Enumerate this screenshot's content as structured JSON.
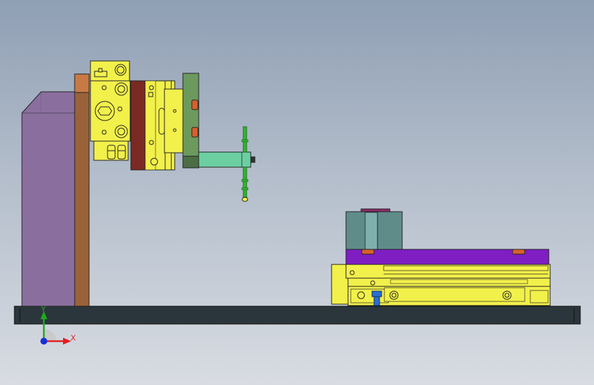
{
  "viewport": {
    "background_top": "#8f9fb4",
    "background_bottom": "#d8dce2"
  },
  "triad": {
    "x_label": "X",
    "y_label": "Y",
    "x_color": "#e02020",
    "y_color": "#1fa81f",
    "z_color": "#1a2fd6"
  },
  "colors": {
    "base_plate": "#2a363b",
    "column": "#8a6f9e",
    "column_bar": "#9a6238",
    "yellow_block": "#f2f04a",
    "red_plate": "#7a2a23",
    "green_block": "#6c9a5e",
    "mint_arm": "#6ccfa2",
    "purple_plate": "#7f1ec3",
    "teal_block": "#5f8c89",
    "probe": "#2eb82e",
    "screw": "#2b6ed1",
    "orange_pad": "#d7612a"
  }
}
